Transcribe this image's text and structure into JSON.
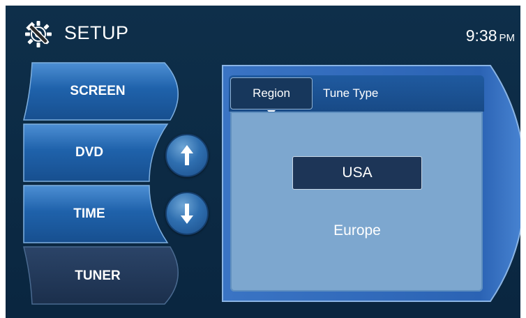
{
  "header": {
    "title": "SETUP",
    "time": "9:38",
    "ampm": "PM",
    "icon": "gear-wrench-icon"
  },
  "menu": {
    "items": [
      {
        "label": "SCREEN",
        "selected": false
      },
      {
        "label": "DVD",
        "selected": false
      },
      {
        "label": "TIME",
        "selected": false
      },
      {
        "label": "TUNER",
        "selected": true
      }
    ],
    "scroll_up_icon": "arrow-up-icon",
    "scroll_down_icon": "arrow-down-icon"
  },
  "panel": {
    "tabs": [
      {
        "label": "Region",
        "selected": true
      },
      {
        "label": "Tune Type",
        "selected": false
      }
    ],
    "options": [
      {
        "label": "USA",
        "selected": true
      },
      {
        "label": "Europe",
        "selected": false
      }
    ]
  },
  "colors": {
    "background": "#0c2a44",
    "menu_button": "#1f5fa8",
    "menu_selected": "#1e3554",
    "panel_frame": "#2b63b4",
    "content": "#7da7cf",
    "selected_option": "#1d3557"
  }
}
